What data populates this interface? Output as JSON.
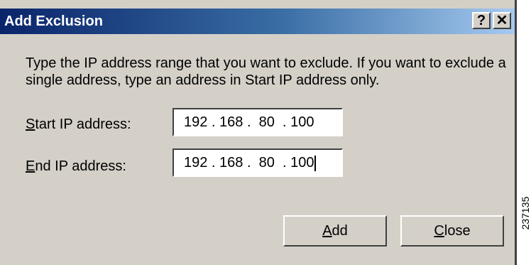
{
  "dialog": {
    "title": "Add Exclusion",
    "help_glyph": "?",
    "close_glyph": "✕",
    "description": "Type the IP address range that you want to exclude. If you want to exclude a single address, type an address in Start IP address only.",
    "start_ip": {
      "label_mnemonic": "S",
      "label_rest": "tart IP address:",
      "value": "192 . 168 .  80  . 100"
    },
    "end_ip": {
      "label_mnemonic": "E",
      "label_rest": "nd IP address:",
      "value": "192 . 168 .  80  . 100"
    },
    "buttons": {
      "add_mnemonic": "A",
      "add_rest": "dd",
      "close_mnemonic": "C",
      "close_rest": "lose"
    }
  },
  "figure_id": "237135",
  "colors": {
    "dialog_bg": "#d4d0c8",
    "title_gradient_start": "#0a246a",
    "title_gradient_end": "#a6caf0",
    "title_text": "#ffffff"
  }
}
